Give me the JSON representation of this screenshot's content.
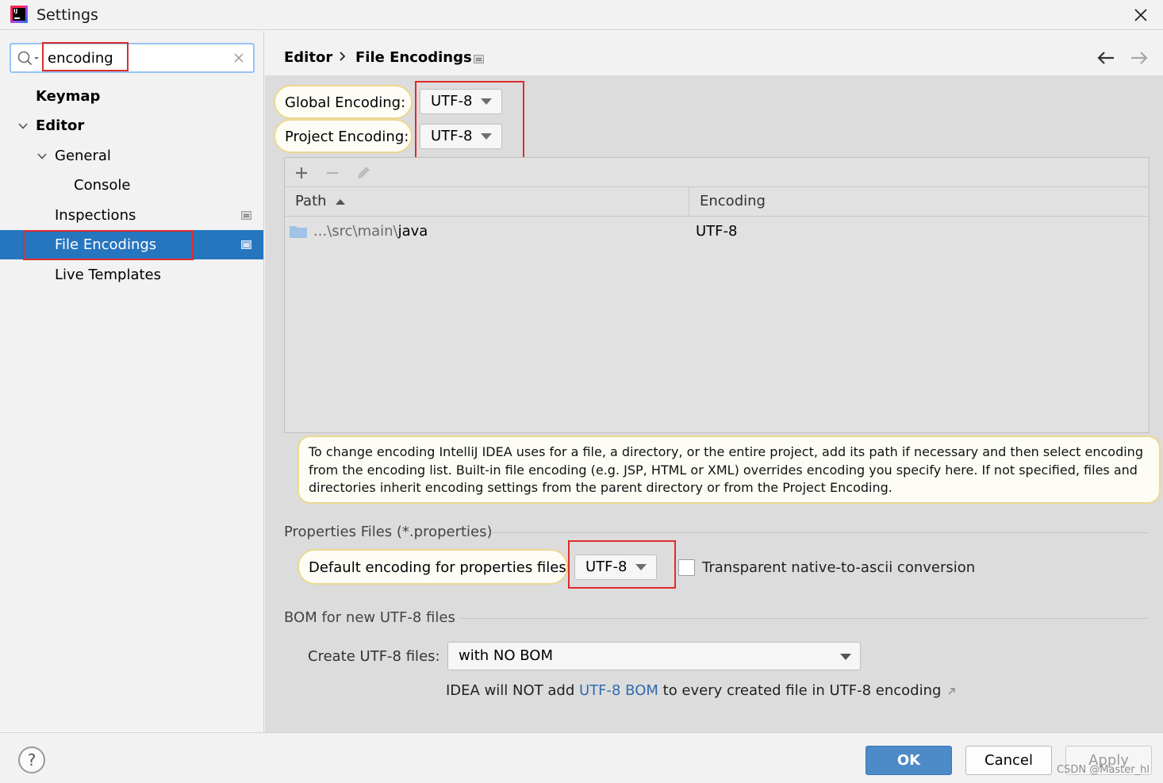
{
  "window": {
    "title": "Settings"
  },
  "search": {
    "value": "encoding"
  },
  "sidebar": {
    "items": [
      {
        "label": "Keymap"
      },
      {
        "label": "Editor"
      },
      {
        "label": "General"
      },
      {
        "label": "Console"
      },
      {
        "label": "Inspections"
      },
      {
        "label": "File Encodings"
      },
      {
        "label": "Live Templates"
      }
    ]
  },
  "breadcrumb": {
    "parent": "Editor",
    "current": "File Encodings"
  },
  "global_encoding": {
    "label": "Global Encoding:",
    "value": "UTF-8"
  },
  "project_encoding": {
    "label": "Project Encoding:",
    "value": "UTF-8"
  },
  "table": {
    "columns": [
      "Path",
      "Encoding"
    ],
    "rows": [
      {
        "path_prefix": "...\\src\\main\\",
        "path_last": "java",
        "encoding": "UTF-8"
      }
    ]
  },
  "info_note": "To change encoding IntelliJ IDEA uses for a file, a directory, or the entire project, add its path if necessary and then select encoding from the encoding list. Built-in file encoding (e.g. JSP, HTML or XML) overrides encoding you specify here. If not specified, files and directories inherit encoding settings from the parent directory or from the Project Encoding.",
  "properties": {
    "section_title": "Properties Files (*.properties)",
    "default_label": "Default encoding for properties files:",
    "default_value": "UTF-8",
    "transparent_label": "Transparent native-to-ascii conversion",
    "transparent_checked": false
  },
  "bom": {
    "section_title": "BOM for new UTF-8 files",
    "create_label": "Create UTF-8 files:",
    "create_value": "with NO BOM",
    "hint_before": "IDEA will NOT add ",
    "hint_link": "UTF-8 BOM",
    "hint_after": " to every created file in UTF-8 encoding"
  },
  "footer": {
    "help_label": "?",
    "ok_label": "OK",
    "cancel_label": "Cancel",
    "apply_label": "Apply",
    "watermark": "CSDN @Master_hl"
  },
  "colors": {
    "selection": "#2675bf",
    "highlight_box": "#e02b2b",
    "ok_button": "#4d8ac8",
    "link": "#2f6bb0"
  }
}
